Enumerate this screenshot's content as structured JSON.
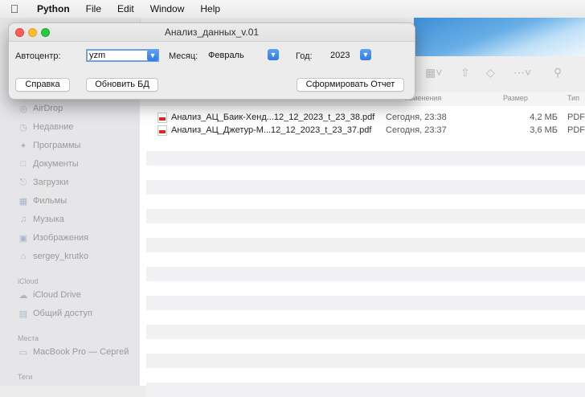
{
  "menubar": {
    "app_name": "Python",
    "items": [
      "File",
      "Edit",
      "Window",
      "Help"
    ]
  },
  "sidebar": {
    "favorites": [
      {
        "label": "AirDrop",
        "icon": "airdrop-icon"
      },
      {
        "label": "Недавние",
        "icon": "clock-icon"
      },
      {
        "label": "Программы",
        "icon": "apps-icon"
      },
      {
        "label": "Документы",
        "icon": "document-icon"
      },
      {
        "label": "Загрузки",
        "icon": "download-icon"
      },
      {
        "label": "Фильмы",
        "icon": "film-icon"
      },
      {
        "label": "Музыка",
        "icon": "music-icon"
      },
      {
        "label": "Изображения",
        "icon": "photo-icon"
      },
      {
        "label": "sergey_krutko",
        "icon": "home-icon"
      }
    ],
    "icloud_heading": "iCloud",
    "icloud": [
      {
        "label": "iCloud Drive",
        "icon": "cloud-icon"
      },
      {
        "label": "Общий доступ",
        "icon": "shared-folder-icon"
      }
    ],
    "places_heading": "Места",
    "places": [
      {
        "label": "MacBook Pro — Сергей",
        "icon": "laptop-icon"
      }
    ],
    "tags_heading": "Теги"
  },
  "columns": {
    "date": "изменения",
    "size": "Размер",
    "type": "Тип"
  },
  "files": [
    {
      "name": "Анализ_АЦ_Баик-Хенд...12_12_2023_t_23_38.pdf",
      "date": "Сегодня, 23:38",
      "size": "4,2 МБ",
      "type": "PDF"
    },
    {
      "name": "Анализ_АЦ_Джетур-М...12_12_2023_t_23_37.pdf",
      "date": "Сегодня, 23:37",
      "size": "3,6 МБ",
      "type": "PDF"
    }
  ],
  "dialog": {
    "title": "Анализ_данных_v.01",
    "dealer_label": "Автоцентр:",
    "dealer_value": "yzm",
    "month_label": "Месяц:",
    "month_value": "Февраль",
    "year_label": "Год:",
    "year_value": "2023",
    "help_button": "Справка",
    "refresh_button": "Обновить БД",
    "report_button": "Сформировать Отчет"
  }
}
